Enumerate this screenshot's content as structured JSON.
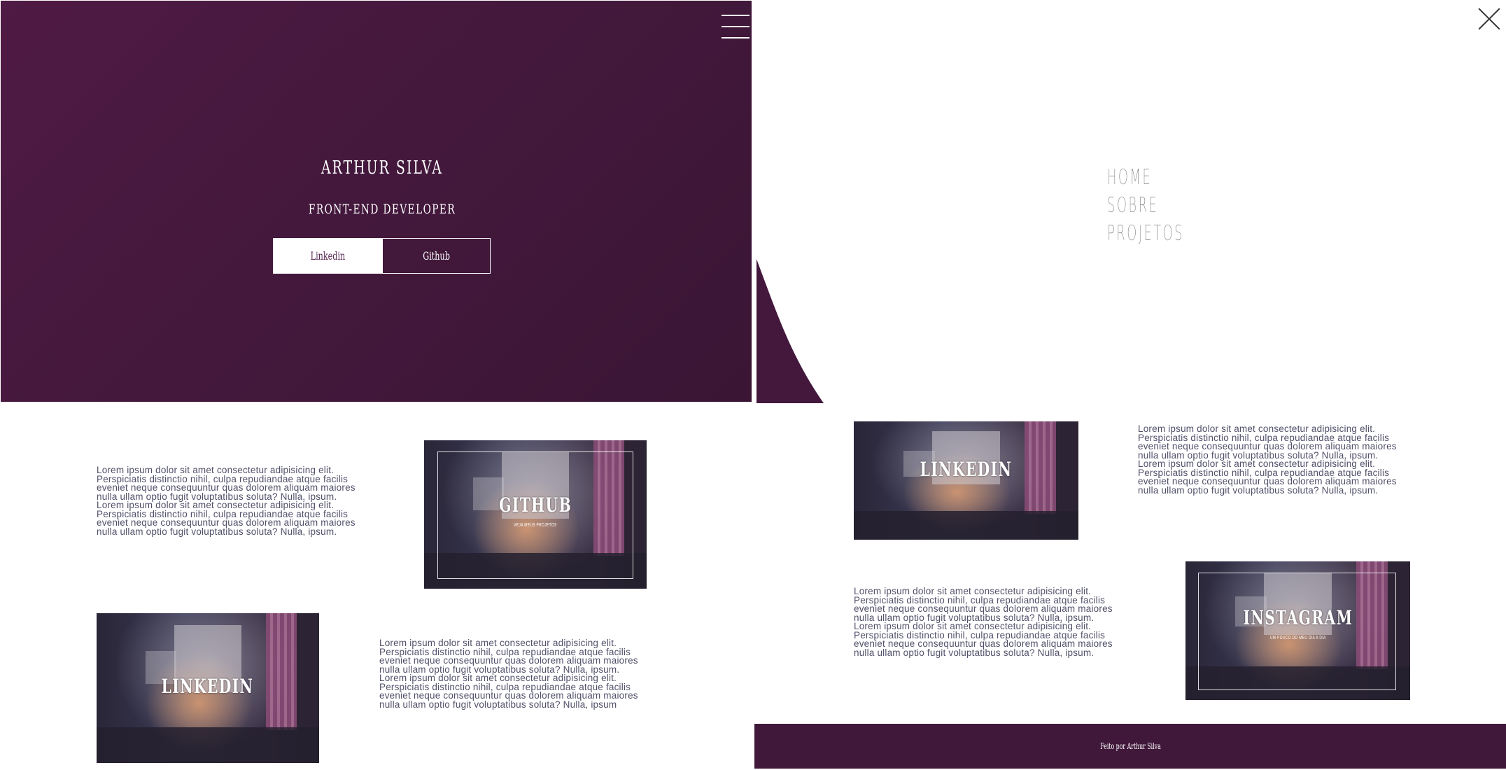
{
  "left_panel": {
    "hero": {
      "name": "ARTHUR SILVA",
      "role": "FRONT-END DEVELOPER",
      "buttons": {
        "linkedin": "Linkedin",
        "github": "Github"
      },
      "background_color": "#43183c"
    },
    "sections": [
      {
        "text": "Lorem ipsum dolor sit amet consectetur adipisicing elit.\nPerspiciatis distinctio nihil, culpa repudiandae atque facilis\neveniet neque consequuntur quas dolorem aliquam maiores\nnulla ullam optio fugit voluptatibus soluta? Nulla, ipsum.\nLorem ipsum dolor sit amet consectetur adipisicing elit.\nPerspiciatis distinctio nihil, culpa repudiandae atque facilis\neveniet neque consequuntur quas dolorem aliquam maiores\nnulla ullam optio fugit voluptatibus soluta? Nulla, ipsum.",
        "card": {
          "title": "GITHUB",
          "subtitle": "VEJA MEUS PROJETOS"
        }
      },
      {
        "card": {
          "title": "LINKEDIN"
        },
        "text": "Lorem ipsum dolor sit amet consectetur adipisicing elit.\nPerspiciatis distinctio nihil, culpa repudiandae atque facilis\neveniet neque consequuntur quas dolorem aliquam maiores\nnulla ullam optio fugit voluptatibus soluta? Nulla, ipsum.\nLorem ipsum dolor sit amet consectetur adipisicing elit.\nPerspiciatis distinctio nihil, culpa repudiandae atque facilis\neveniet neque consequuntur quas dolorem aliquam maiores\nnulla ullam optio fugit voluptatibus soluta? Nulla, ipsum"
      }
    ]
  },
  "right_panel": {
    "menu": [
      "HOME",
      "SOBRE",
      "PROJETOS"
    ],
    "sections": [
      {
        "card": {
          "title": "LINKEDIN"
        },
        "text": "Lorem ipsum dolor sit amet consectetur adipisicing elit.\nPerspiciatis distinctio nihil, culpa repudiandae atque facilis\neveniet neque consequuntur quas dolorem aliquam maiores\nnulla ullam optio fugit voluptatibus soluta? Nulla, ipsum.\nLorem ipsum dolor sit amet consectetur adipisicing elit.\nPerspiciatis distinctio nihil, culpa repudiandae atque facilis\neveniet neque consequuntur quas dolorem aliquam maiores\nnulla ullam optio fugit voluptatibus soluta? Nulla, ipsum."
      },
      {
        "text": "Lorem ipsum dolor sit amet consectetur adipisicing elit.\nPerspiciatis distinctio nihil, culpa repudiandae atque facilis\neveniet neque consequuntur quas dolorem aliquam maiores\nnulla ullam optio fugit voluptatibus soluta? Nulla, ipsum.\nLorem ipsum dolor sit amet consectetur adipisicing elit.\nPerspiciatis distinctio nihil, culpa repudiandae atque facilis\neveniet neque consequuntur quas dolorem aliquam maiores\nnulla ullam optio fugit voluptatibus soluta? Nulla, ipsum.",
        "card": {
          "title": "INSTAGRAM",
          "subtitle": "UM POUCO DO MEU DIA A DIA"
        }
      }
    ],
    "footer": "Feito por Arthur Silva",
    "footer_color": "#40183a"
  },
  "icons": {
    "menu": "hamburger-icon",
    "close": "close-icon"
  }
}
